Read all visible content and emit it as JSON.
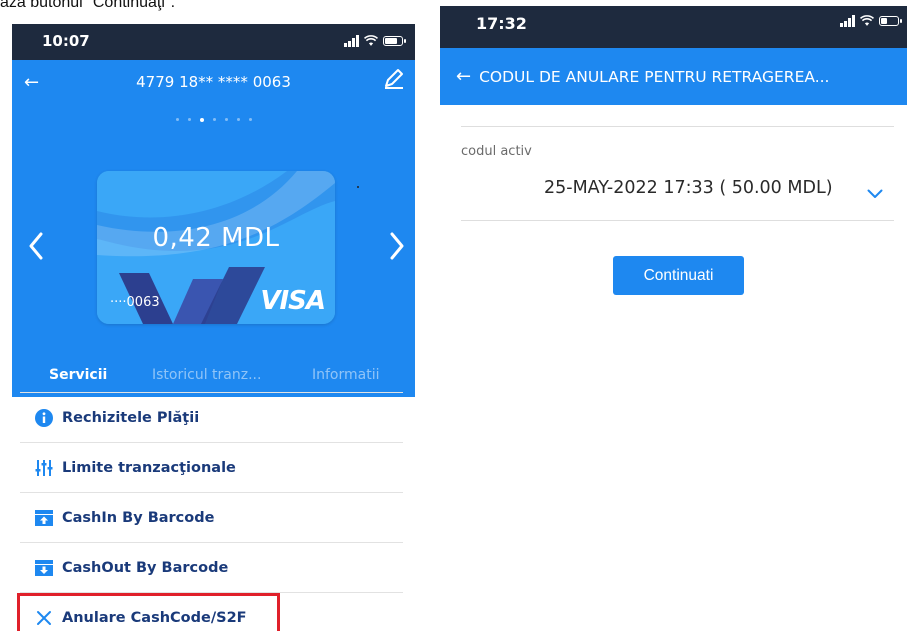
{
  "caption": "ază butonul \"Continuaţi\".",
  "left_phone": {
    "status_time": "10:07",
    "header": {
      "back_label": "←",
      "card_number": "4779 18** **** 0063"
    },
    "card": {
      "balance": "0,42 MDL",
      "last4": "····0063",
      "brand": "VISA"
    },
    "pager": {
      "total": 7,
      "active": 2
    },
    "tabs": [
      {
        "label": "Servicii"
      },
      {
        "label": "Istoricul tranz..."
      },
      {
        "label": "Informatii"
      }
    ],
    "menu": [
      {
        "label": "Rechizitele Plăţii",
        "icon": "info-icon"
      },
      {
        "label": "Limite tranzacţionale",
        "icon": "sliders-icon"
      },
      {
        "label": "CashIn By Barcode",
        "icon": "cashin-barcode-icon"
      },
      {
        "label": "CashOut By Barcode",
        "icon": "cashout-barcode-icon"
      },
      {
        "label": "Anulare CashCode/S2F",
        "icon": "close-icon"
      }
    ],
    "colors": {
      "brand_blue": "#1e88f0",
      "status_bar": "#1e2a3e",
      "menu_text": "#1a3a7a",
      "highlight": "#e0202a"
    }
  },
  "right_phone": {
    "status_time": "17:32",
    "header": {
      "back_label": "←",
      "title": "CODUL DE ANULARE PENTRU RETRAGEREA..."
    },
    "field_label": "codul activ",
    "field_value": "25-MAY-2022 17:33 ( 50.00 MDL)",
    "continue_label": "Continuati"
  }
}
